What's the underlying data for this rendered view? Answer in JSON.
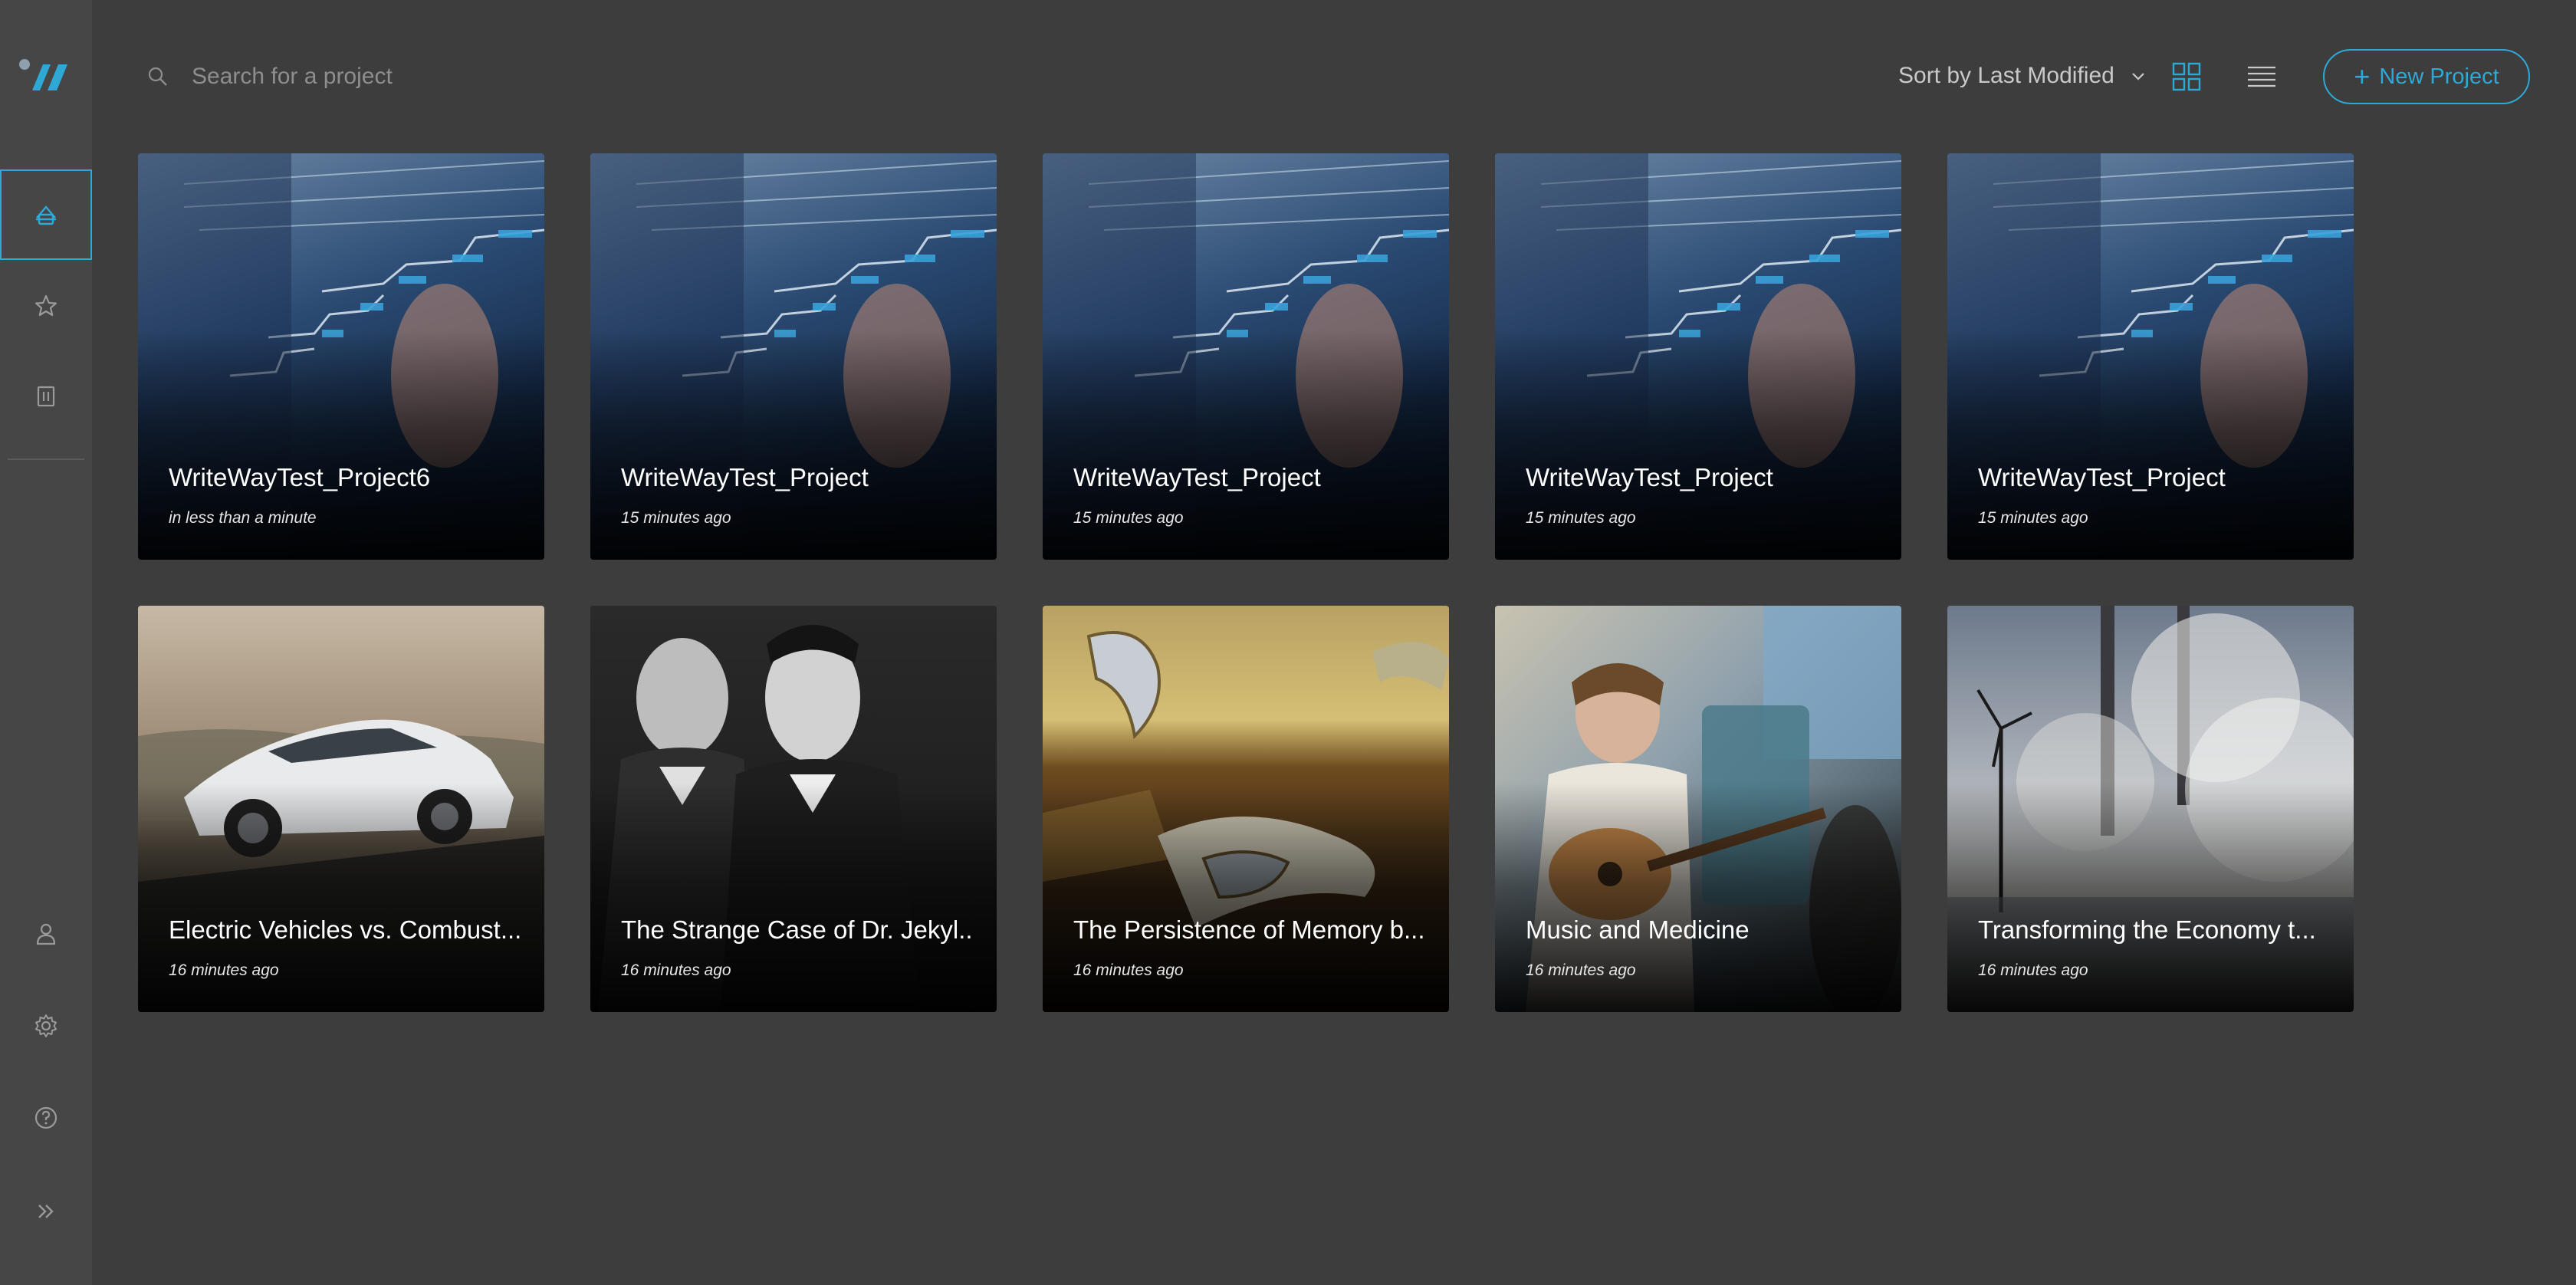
{
  "search": {
    "placeholder": "Search for a project"
  },
  "toolbar": {
    "sort_label": "Sort by Last Modified",
    "new_project_label": "New Project"
  },
  "colors": {
    "accent": "#2ea9d6",
    "background": "#3d3d3d",
    "sidebar": "#464646"
  },
  "sidebar": {
    "items": [
      {
        "icon": "home-icon",
        "active": true
      },
      {
        "icon": "star-icon",
        "active": false
      },
      {
        "icon": "trash-icon",
        "active": false
      },
      {
        "icon": "user-icon",
        "active": false
      },
      {
        "icon": "gear-icon",
        "active": false
      },
      {
        "icon": "help-icon",
        "active": false
      },
      {
        "icon": "expand-icon",
        "active": false
      }
    ]
  },
  "projects": [
    {
      "title": "WriteWayTest_Project6",
      "time": "in less than a minute",
      "image": "chart-hand"
    },
    {
      "title": "WriteWayTest_Project",
      "time": "15 minutes ago",
      "image": "chart-hand"
    },
    {
      "title": "WriteWayTest_Project",
      "time": "15 minutes ago",
      "image": "chart-hand"
    },
    {
      "title": "WriteWayTest_Project",
      "time": "15 minutes ago",
      "image": "chart-hand"
    },
    {
      "title": "WriteWayTest_Project",
      "time": "15 minutes ago",
      "image": "chart-hand"
    },
    {
      "title": "Electric Vehicles vs. Combust...",
      "time": "16 minutes ago",
      "image": "white-suv"
    },
    {
      "title": "The Strange Case of Dr. Jekyl...",
      "time": "16 minutes ago",
      "image": "bw-portrait"
    },
    {
      "title": "The Persistence of Memory b...",
      "time": "16 minutes ago",
      "image": "melting-clocks"
    },
    {
      "title": "Music and Medicine",
      "time": "16 minutes ago",
      "image": "guitar-player"
    },
    {
      "title": "Transforming the Economy t...",
      "time": "16 minutes ago",
      "image": "smokestacks"
    }
  ]
}
